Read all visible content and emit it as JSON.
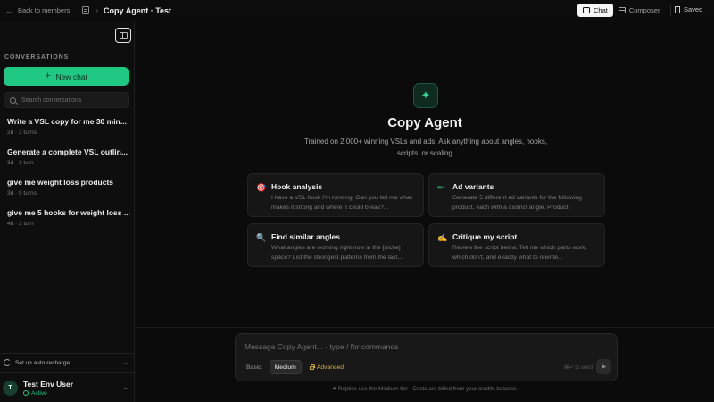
{
  "topbar": {
    "back_label": "Back to members",
    "title": "Copy Agent · Test",
    "tabs": [
      {
        "label": "Chat",
        "icon": "chat-bubble-icon",
        "active": true
      },
      {
        "label": "Composer",
        "icon": "composer-icon",
        "active": false
      }
    ],
    "saved_label": "Saved"
  },
  "sidebar": {
    "section_title": "CONVERSATIONS",
    "new_chat_label": "New chat",
    "search_placeholder": "Search conversations",
    "conversations": [
      {
        "title": "Write a VSL copy for me 30 min...",
        "meta": "2d · 3 turns"
      },
      {
        "title": "Generate a complete VSL outlin...",
        "meta": "3d · 1 turn"
      },
      {
        "title": "give me weight loss products",
        "meta": "3d · 9 turns"
      },
      {
        "title": "give me 5 hooks for weight loss ...",
        "meta": "4d · 1 turn"
      }
    ],
    "recharge_label": "Set up auto-recharge",
    "user": {
      "initial": "T",
      "name": "Test Env User",
      "status": "Active"
    }
  },
  "main": {
    "title": "Copy Agent",
    "subtitle": "Trained on 2,000+ winning VSLs and ads. Ask anything about angles, hooks, scripts, or scaling.",
    "cards": [
      {
        "title": "Hook analysis",
        "desc": "I have a VSL hook I'm running. Can you tell me what makes it strong and where it could break?...",
        "icon": "target-icon",
        "glyph": "🎯"
      },
      {
        "title": "Ad variants",
        "desc": "Generate 5 different ad variants for the following product, each with a distinct angle. Product:",
        "icon": "pencil-icon",
        "glyph": "✏"
      },
      {
        "title": "Find similar angles",
        "desc": "What angles are working right now in the [niche] space? List the strongest patterns from the last...",
        "icon": "magnifier-icon",
        "glyph": "🔍"
      },
      {
        "title": "Critique my script",
        "desc": "Review the script below. Tell me which parts work, which don't, and exactly what to rewrite...",
        "icon": "pen-icon",
        "glyph": "✍"
      }
    ]
  },
  "composer": {
    "placeholder": "Message Copy Agent... · type / for commands",
    "modes": [
      {
        "label": "Basic"
      },
      {
        "label": "Medium",
        "selected": true
      },
      {
        "label": "Advanced",
        "locked": true
      }
    ],
    "send_hint": "⌘↵ to send",
    "footnote": "Replies use the Medium tier · Costs are billed from your credits balance."
  },
  "colors": {
    "accent": "#1fc983",
    "advanced": "#d9b341",
    "background": "#0c0c0c"
  }
}
